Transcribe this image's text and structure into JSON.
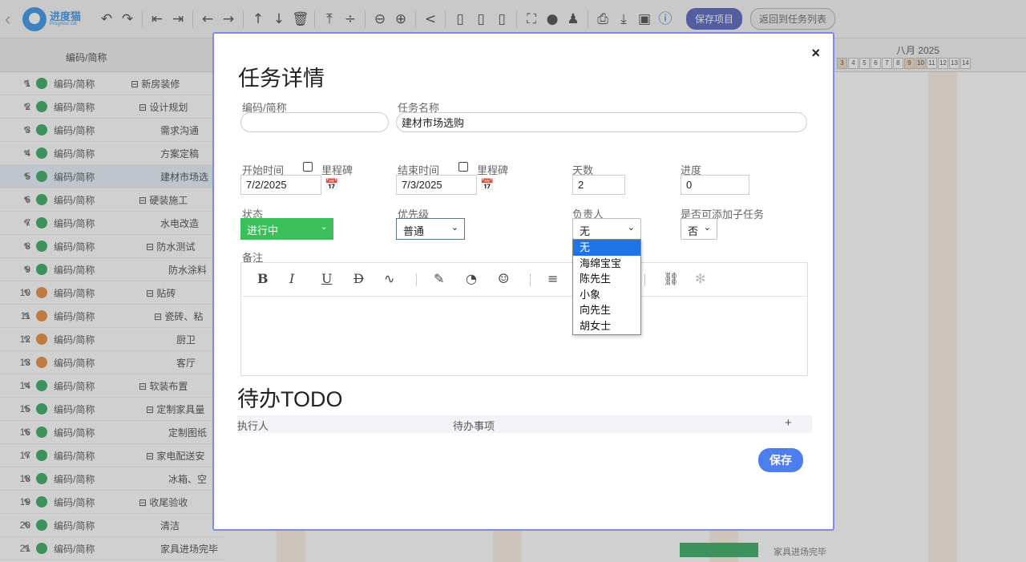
{
  "toolbar": {
    "logo_cn": "进度猫",
    "logo_en": "Progress cat",
    "save_project": "保存项目",
    "return_list": "返回到任务列表"
  },
  "grid": {
    "header_code": "编码/简称",
    "month": "八月 2025",
    "days": [
      "3",
      "4",
      "5",
      "6",
      "7",
      "8",
      "9",
      "10",
      "11",
      "12",
      "13",
      "14"
    ],
    "rows": [
      {
        "n": "1",
        "dot": "#1e9e4a",
        "code": "编码/简称",
        "name": "⊟ 新房装修",
        "indent": 163
      },
      {
        "n": "2",
        "dot": "#1e9e4a",
        "code": "编码/简称",
        "name": "⊟ 设计规划",
        "indent": 173
      },
      {
        "n": "3",
        "dot": "#1e9e4a",
        "code": "编码/简称",
        "name": "需求沟通",
        "indent": 200
      },
      {
        "n": "4",
        "dot": "#1e9e4a",
        "code": "编码/简称",
        "name": "方案定稿",
        "indent": 200
      },
      {
        "n": "5",
        "dot": "#1e9e4a",
        "code": "编码/简称",
        "name": "建材市场选",
        "indent": 200
      },
      {
        "n": "6",
        "dot": "#1e9e4a",
        "code": "编码/简称",
        "name": "⊟ 硬装施工",
        "indent": 173
      },
      {
        "n": "7",
        "dot": "#1e9e4a",
        "code": "编码/简称",
        "name": "水电改造",
        "indent": 200
      },
      {
        "n": "8",
        "dot": "#1e9e4a",
        "code": "编码/简称",
        "name": "⊟ 防水测试",
        "indent": 182
      },
      {
        "n": "9",
        "dot": "#1e9e4a",
        "code": "编码/简称",
        "name": "防水涂料",
        "indent": 210
      },
      {
        "n": "10",
        "dot": "#e67e22",
        "code": "编码/简称",
        "name": "⊟ 贴砖",
        "indent": 182
      },
      {
        "n": "11",
        "dot": "#e67e22",
        "code": "编码/简称",
        "name": "⊟ 瓷砖、粘",
        "indent": 192
      },
      {
        "n": "12",
        "dot": "#e67e22",
        "code": "编码/简称",
        "name": "厨卫",
        "indent": 220
      },
      {
        "n": "13",
        "dot": "#e67e22",
        "code": "编码/简称",
        "name": "客厅",
        "indent": 220
      },
      {
        "n": "14",
        "dot": "#1e9e4a",
        "code": "编码/简称",
        "name": "⊟ 软装布置",
        "indent": 173
      },
      {
        "n": "15",
        "dot": "#1e9e4a",
        "code": "编码/简称",
        "name": "⊟ 定制家具量",
        "indent": 182
      },
      {
        "n": "16",
        "dot": "#1e9e4a",
        "code": "编码/简称",
        "name": "定制图纸",
        "indent": 210
      },
      {
        "n": "17",
        "dot": "#1e9e4a",
        "code": "编码/简称",
        "name": "⊟ 家电配送安",
        "indent": 182
      },
      {
        "n": "18",
        "dot": "#1e9e4a",
        "code": "编码/简称",
        "name": "冰箱、空",
        "indent": 210
      },
      {
        "n": "19",
        "dot": "#1e9e4a",
        "code": "编码/简称",
        "name": "⊟ 收尾验收",
        "indent": 173
      },
      {
        "n": "20",
        "dot": "#1e9e4a",
        "code": "编码/简称",
        "name": "清洁",
        "indent": 200
      },
      {
        "n": "21",
        "dot": "#1e9e4a",
        "code": "编码/简称",
        "name": "家具进场完毕",
        "indent": 200
      }
    ],
    "bar_label": "家具进场完毕"
  },
  "modal": {
    "title": "任务详情",
    "code_label": "编码/简称",
    "code_value": "",
    "name_label": "任务名称",
    "name_value": "建材市场选购",
    "start_label": "开始时间",
    "start_milestone": "里程碑",
    "start_value": "7/2/2025",
    "end_label": "结束时间",
    "end_milestone": "里程碑",
    "end_value": "7/3/2025",
    "days_label": "天数",
    "days_value": "2",
    "progress_label": "进度",
    "progress_value": "0",
    "status_label": "状态",
    "status_value": "进行中",
    "priority_label": "优先级",
    "priority_value": "普通",
    "owner_label": "负责人",
    "owner_value": "无",
    "subtask_label": "是否可添加子任务",
    "subtask_value": "否",
    "notes_label": "备注",
    "owner_options": [
      "无",
      "海绵宝宝",
      "陈先生",
      "小象",
      "向先生",
      "胡女士"
    ],
    "todo_title": "待办TODO",
    "todo_col_executor": "执行人",
    "todo_col_item": "待办事项",
    "todo_add": "+",
    "save": "保存",
    "close": "×"
  },
  "colors": {
    "accent": "#4d7ef0",
    "status_green": "#3bbf5a",
    "selected": "#1e74e5"
  }
}
